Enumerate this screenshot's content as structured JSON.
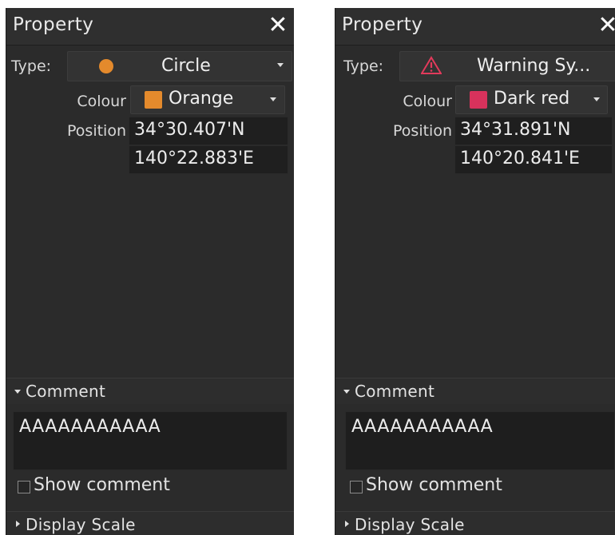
{
  "panels": [
    {
      "title": "Property",
      "close_icon": "close-icon",
      "type_label": "Type:",
      "type_icon": "orange-circle-icon",
      "type_value": "Circle",
      "colour_label": "Colour",
      "colour_value": "Orange",
      "colour_hex": "#e48a2c",
      "position_label": "Position",
      "latitude": "34°30.407'N",
      "longitude": "140°22.883'E",
      "comment_header": "Comment",
      "comment_text": "AAAAAAAAAAA",
      "show_comment_label": "Show comment",
      "show_comment_checked": false,
      "display_scale_header": "Display Scale"
    },
    {
      "title": "Property",
      "close_icon": "close-icon",
      "type_label": "Type:",
      "type_icon": "warning-triangle-icon",
      "type_value": "Warning Sy...",
      "colour_label": "Colour",
      "colour_value": "Dark red",
      "colour_hex": "#d8325c",
      "position_label": "Position",
      "latitude": "34°31.891'N",
      "longitude": "140°20.841'E",
      "comment_header": "Comment",
      "comment_text": "AAAAAAAAAAA",
      "show_comment_label": "Show comment",
      "show_comment_checked": false,
      "display_scale_header": "Display Scale"
    }
  ]
}
